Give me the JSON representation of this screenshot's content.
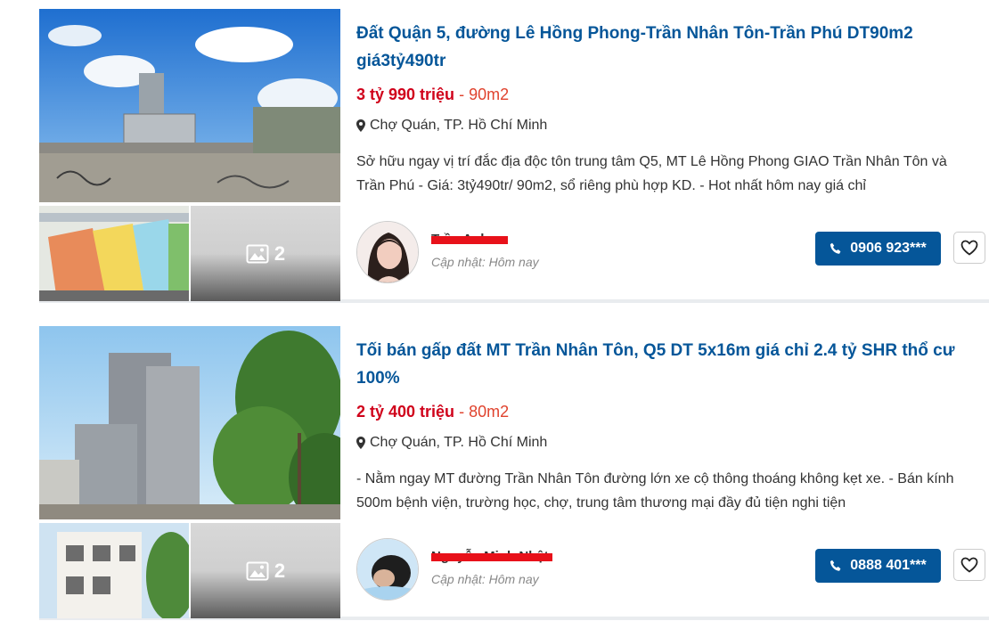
{
  "listings": [
    {
      "title": "Đất Quận 5, đường Lê Hồng Phong-Trần Nhân Tôn-Trần Phú DT90m2 giá3tỷ490tr",
      "price": "3 tỷ 990 triệu",
      "separator": " - ",
      "area": "90m2",
      "location": "Chợ Quán, TP. Hồ Chí Minh",
      "description": "Sở hữu ngay vị trí đắc địa độc tôn trung tâm Q5, MT Lê Hồng Phong GIAO Trần Nhân Tôn và Trần Phú - Giá: 3tỷ490tr/ 90m2, sổ riêng phù hợp KD. - Hot nhất hôm nay giá chỉ",
      "more_images": "2",
      "agent_name": "Trần Anh",
      "updated": "Cập nhật: Hôm nay",
      "phone": "0906 923***",
      "icons": {
        "location": "map-pin-icon",
        "phone": "phone-icon",
        "favorite": "heart-icon",
        "gallery": "image-icon"
      }
    },
    {
      "title": "Tối bán gấp đất MT Trần Nhân Tôn, Q5 DT 5x16m giá chỉ 2.4 tỷ SHR thổ cư 100%",
      "price": "2 tỷ 400 triệu",
      "separator": " - ",
      "area": "80m2",
      "location": "Chợ Quán, TP. Hồ Chí Minh",
      "description": "- Nằm ngay MT đường Trần Nhân Tôn đường lớn xe cộ thông thoáng không kẹt xe. - Bán kính 500m bệnh viện, trường học, chợ, trung tâm thương mại đầy đủ tiện nghi tiện",
      "more_images": "2",
      "agent_name": "Nguyễn Minh Nhật",
      "updated": "Cập nhật: Hôm nay",
      "phone": "0888 401***",
      "icons": {
        "location": "map-pin-icon",
        "phone": "phone-icon",
        "favorite": "heart-icon",
        "gallery": "image-icon"
      }
    }
  ],
  "colors": {
    "title": "#055699",
    "price": "#d0021b",
    "button": "#055699"
  }
}
